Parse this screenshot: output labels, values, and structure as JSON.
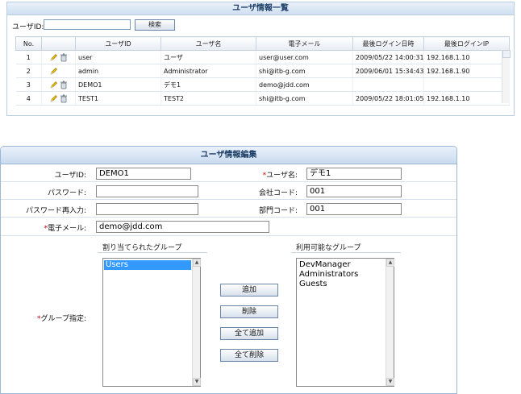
{
  "list": {
    "title": "ユーザ情報一覧",
    "search_label": "ユーザID:",
    "search_value": "",
    "search_button": "検索",
    "columns": [
      "No.",
      "",
      "ユーザID",
      "ユーザ名",
      "電子メール",
      "最後ログイン日時",
      "最後ログインIP"
    ],
    "rows": [
      {
        "no": "1",
        "user_id": "user",
        "user_name": "ユーザ",
        "email": "user@user.com",
        "last_login": "2009/05/22 14:00:31",
        "last_ip": "192.168.1.10",
        "can_delete": true
      },
      {
        "no": "2",
        "user_id": "admin",
        "user_name": "Administrator",
        "email": "shi@itb-g.com",
        "last_login": "2009/06/01 15:34:43",
        "last_ip": "192.168.1.90",
        "can_delete": false
      },
      {
        "no": "3",
        "user_id": "DEMO1",
        "user_name": "デモ1",
        "email": "demo@jdd.com",
        "last_login": "",
        "last_ip": "",
        "can_delete": true
      },
      {
        "no": "4",
        "user_id": "TEST1",
        "user_name": "TEST2",
        "email": "shi@itb-g.com",
        "last_login": "2009/05/22 18:01:05",
        "last_ip": "192.168.1.10",
        "can_delete": true
      }
    ]
  },
  "edit": {
    "title": "ユーザ情報編集",
    "user_id_label": "ユーザID:",
    "user_id_value": "DEMO1",
    "user_name_label": "ユーザ名:",
    "user_name_value": "デモ1",
    "password_label": "パスワード:",
    "password_value": "",
    "company_code_label": "会社コード:",
    "company_code_value": "001",
    "password_confirm_label": "パスワード再入力:",
    "password_confirm_value": "",
    "dept_code_label": "部門コード:",
    "dept_code_value": "001",
    "email_label": "電子メール:",
    "email_value": "demo@jdd.com",
    "group_label": "グループ指定:",
    "assigned_groups_header": "割り当てられたグループ",
    "assigned_groups": [
      "Users"
    ],
    "available_groups_header": "利用可能なグループ",
    "available_groups": [
      "DevManager",
      "Administrators",
      "Guests"
    ],
    "add_button": "追加",
    "remove_button": "削除",
    "add_all_button": "全て追加",
    "remove_all_button": "全て削除"
  },
  "colors": {
    "panel_border": "#9db7d6",
    "title_text": "#1c3d66",
    "required": "#d40000",
    "selection": "#3399ff"
  },
  "icons": {
    "edit": "pencil-icon",
    "delete": "trash-icon"
  }
}
